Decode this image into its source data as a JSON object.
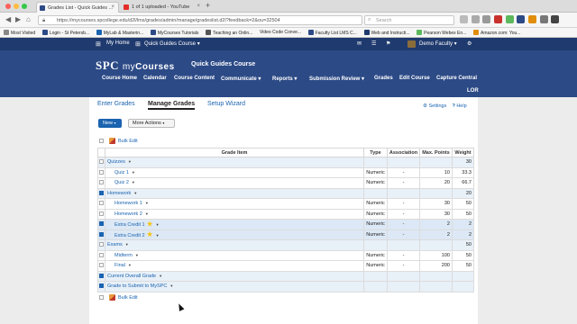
{
  "browser": {
    "tabs": [
      {
        "label": "Grades List - Quick Guides ...",
        "active": true
      },
      {
        "label": "1 of 1 uploaded - YouTube",
        "active": false
      }
    ],
    "url": "https://mycourses.spcollege.edu/d2l/lms/grades/admin/manage/gradeslist.d2l?feedback=2&ou=32504",
    "search_placeholder": "Search",
    "bookmarks": [
      "Most Visited",
      "Login - St Petersb...",
      "MyLab & Masterin...",
      "MyCourses Tutorials",
      "Teaching an Onlin...",
      "Video Code Conve...",
      "Faculty List LMS C...",
      "Web and Instructi...",
      "Pearson Webex En...",
      "Amazon.com: You..."
    ]
  },
  "lms": {
    "home": "My Home",
    "course_selector": "Quick Guides Course",
    "user": "Demo Faculty",
    "logo_spc": "SPC",
    "logo_my": "my",
    "logo_courses": "Courses",
    "course_title": "Quick Guides Course",
    "nav": [
      "Course Home",
      "Calendar",
      "Course Content",
      "Communicate",
      "Reports",
      "Submission Review",
      "Grades",
      "Edit Course",
      "Capture Central"
    ],
    "nav_lor": "LOR"
  },
  "page": {
    "subtabs": [
      "Enter Grades",
      "Manage Grades",
      "Setup Wizard"
    ],
    "settings": "Settings",
    "help": "Help",
    "new_button": "New",
    "more_actions": "More Actions",
    "bulk_edit": "Bulk Edit"
  },
  "table": {
    "headers": [
      "Grade Item",
      "Type",
      "Association",
      "Max. Points",
      "Weight"
    ],
    "rows": [
      {
        "name": "Quizzes",
        "type": "",
        "assoc": "",
        "max": "",
        "weight": "30",
        "kind": "cat",
        "checked": false,
        "star": false
      },
      {
        "name": "Quiz 1",
        "type": "Numeric",
        "assoc": "-",
        "max": "10",
        "weight": "33.3",
        "kind": "item",
        "checked": false,
        "star": false
      },
      {
        "name": "Quiz 2",
        "type": "Numeric",
        "assoc": "-",
        "max": "20",
        "weight": "66.7",
        "kind": "item",
        "checked": false,
        "star": false
      },
      {
        "name": "Homework",
        "type": "",
        "assoc": "",
        "max": "",
        "weight": "20",
        "kind": "cat",
        "checked": true,
        "star": false
      },
      {
        "name": "Homework 1",
        "type": "Numeric",
        "assoc": "-",
        "max": "30",
        "weight": "50",
        "kind": "item",
        "checked": false,
        "star": false
      },
      {
        "name": "Homework 2",
        "type": "Numeric",
        "assoc": "-",
        "max": "30",
        "weight": "50",
        "kind": "item",
        "checked": false,
        "star": false
      },
      {
        "name": "Extra Credit 1",
        "type": "Numeric",
        "assoc": "-",
        "max": "2",
        "weight": "2",
        "kind": "sel",
        "checked": true,
        "star": true
      },
      {
        "name": "Extra Credit 2",
        "type": "Numeric",
        "assoc": "-",
        "max": "2",
        "weight": "2",
        "kind": "sel",
        "checked": true,
        "star": true
      },
      {
        "name": "Exams",
        "type": "",
        "assoc": "",
        "max": "",
        "weight": "50",
        "kind": "cat",
        "checked": false,
        "star": false
      },
      {
        "name": "Midterm",
        "type": "Numeric",
        "assoc": "-",
        "max": "100",
        "weight": "50",
        "kind": "item",
        "checked": false,
        "star": false
      },
      {
        "name": "Final",
        "type": "Numeric",
        "assoc": "-",
        "max": "200",
        "weight": "50",
        "kind": "item",
        "checked": false,
        "star": false
      },
      {
        "name": "Current Overall Grade",
        "type": "",
        "assoc": "",
        "max": "",
        "weight": "",
        "kind": "cat",
        "checked": true,
        "star": false
      },
      {
        "name": "Grade to Submit to MySPC",
        "type": "",
        "assoc": "",
        "max": "",
        "weight": "",
        "kind": "cat",
        "checked": true,
        "star": false
      }
    ]
  },
  "colors": {
    "banner": "#2c4a86",
    "topbar": "#1f3a6e",
    "link": "#1a63b0"
  }
}
